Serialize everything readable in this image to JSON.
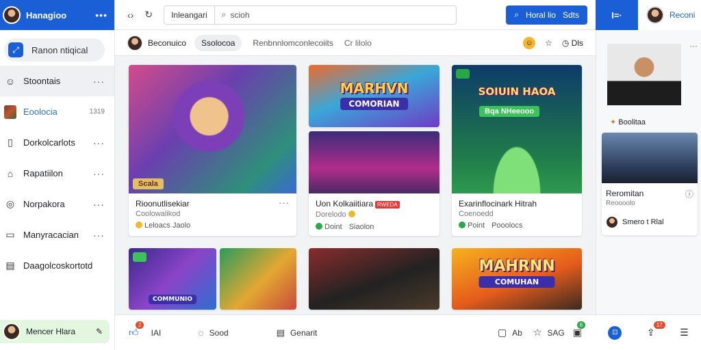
{
  "sidebar": {
    "user_name": "Hanagioo",
    "search_label": "Ranon ntiqical",
    "items": [
      {
        "label": "Stoontais",
        "icon": "smiley-icon"
      },
      {
        "label": "Eoolocia",
        "count": "1319",
        "icon": "game-thumbnail"
      },
      {
        "label": "Dorkolcarlots",
        "icon": "bookmark-icon"
      },
      {
        "label": "Rapatiilon",
        "icon": "home-icon"
      },
      {
        "label": "Norpakora",
        "icon": "bell-icon"
      },
      {
        "label": "Manyracacian",
        "icon": "list-icon"
      },
      {
        "label": "Daagolcoskortotd",
        "icon": "document-icon"
      }
    ],
    "footer_user": "Mencer Hlara"
  },
  "topbar": {
    "address_segment": "Inleangari",
    "search_placeholder": "scioh",
    "primary_button": "Horal lio",
    "primary_button_extra": "Sdts"
  },
  "right_header": {
    "grid_label": "I=·",
    "user_name": "Reconi"
  },
  "subbar": {
    "user_label": "Beconuico",
    "pill_label": "Ssolocoa",
    "link1": "Renbnnlomconlecoiits",
    "link2": "Cr lilolo",
    "right_label": "Dls"
  },
  "cards": [
    {
      "title": "Rioonutlisekiar",
      "subtitle": "Coolowalikod",
      "meta": "Leloacs Jaolo",
      "banner_tag": "Scala"
    },
    {
      "banner": "MARHVN",
      "banner_sub": "COMORIAN"
    },
    {
      "title": "Uon Kolkaiitiara",
      "badge": "RWEDA",
      "subtitle": "Dorelodo",
      "meta1": "Doint",
      "meta2": "Siaolon"
    },
    {
      "banner": "SOIUIN HAOA",
      "tag": "Bqa NHeeooo",
      "title": "Exarinflocinark Hitrah",
      "subtitle": "Coenoedd",
      "meta1": "Point",
      "meta2": "Pooolocs"
    },
    {
      "banner_sub": "COMMUNIO"
    },
    {},
    {},
    {
      "banner": "MAHRNN",
      "banner_sub": "COMUHAN"
    }
  ],
  "right_panel": {
    "card1_label": "Boolitaa",
    "card2_title": "Reromitan",
    "card2_subtitle": "Reoooolo",
    "card2_user": "Smero t Rlal"
  },
  "bottombar": {
    "item1": "IAI",
    "item1_badge": "2",
    "item2": "Sood",
    "item3": "Genarit",
    "item4": "Ab",
    "item5": "SAG",
    "item5_badge": "6",
    "right_badge": "17"
  }
}
